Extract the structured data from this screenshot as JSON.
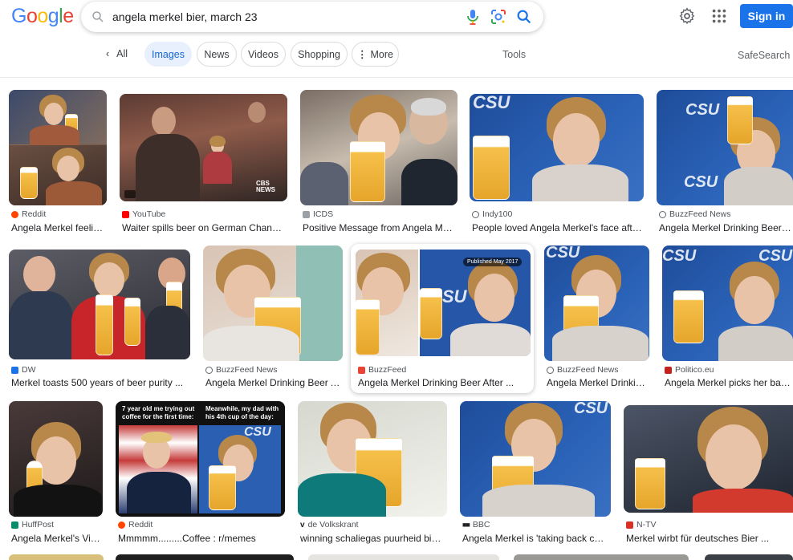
{
  "header": {
    "logo": [
      "G",
      "o",
      "o",
      "g",
      "l",
      "e"
    ],
    "logo_colors": [
      "#4285f4",
      "#ea4335",
      "#fbbc05",
      "#4285f4",
      "#34a853",
      "#ea4335"
    ],
    "query": "angela merkel bier, march 23",
    "signin_label": "Sign in"
  },
  "tabs": {
    "all": "All",
    "items": [
      "Images",
      "News",
      "Videos",
      "Shopping",
      "More"
    ],
    "tools": "Tools",
    "safesearch": "SafeSearch"
  },
  "results": [
    {
      "source": "Reddit",
      "fav": "#ff4500",
      "caption": "Angela Merkel feelin..."
    },
    {
      "source": "YouTube",
      "fav": "#ff0000",
      "caption": "Waiter spills beer on German Chancell...",
      "overlay": "CBS NEWS"
    },
    {
      "source": "ICDS",
      "fav": "#9aa0a6",
      "caption": "Positive Message from Angela Mer..."
    },
    {
      "source": "Indy100",
      "fav": "#5f6368",
      "caption": "People loved Angela Merkel's face after..."
    },
    {
      "source": "BuzzFeed News",
      "fav": "#5f6368",
      "caption": "Angela Merkel Drinking Beer Af..."
    },
    {
      "source": "DW",
      "fav": "#1a73e8",
      "caption": "Merkel toasts 500 years of beer purity ..."
    },
    {
      "source": "BuzzFeed News",
      "fav": "#5f6368",
      "caption": "Angela Merkel Drinking Beer Af..."
    },
    {
      "source": "BuzzFeed",
      "fav": "#ea4335",
      "caption": "Angela Merkel Drinking Beer After ...",
      "badge": "Published May 2017"
    },
    {
      "source": "BuzzFeed News",
      "fav": "#5f6368",
      "caption": "Angela Merkel Drinkin..."
    },
    {
      "source": "Politico.eu",
      "fav": "#c5221f",
      "caption": "Angela Merkel picks her battl..."
    },
    {
      "source": "HuffPost",
      "fav": "#0a8c6c",
      "caption": "Angela Merkel's Vis..."
    },
    {
      "source": "Reddit",
      "fav": "#ff4500",
      "caption": "Mmmmm.........Coffee : r/memes",
      "meme_left": "7 year old me trying out coffee for the first time:",
      "meme_right": "Meanwhile, my dad with his 4th cup of the day:"
    },
    {
      "source": "de Volkskrant",
      "fav": "#202124",
      "caption": "winning schaliegas puurheid bier ..."
    },
    {
      "source": "BBC",
      "fav": "#202124",
      "caption": "Angela Merkel is 'taking back con..."
    },
    {
      "source": "N-TV",
      "fav": "#d93025",
      "caption": "Merkel wirbt für deutsches Bier ..."
    }
  ],
  "scene_text": {
    "csu": "CSU"
  }
}
